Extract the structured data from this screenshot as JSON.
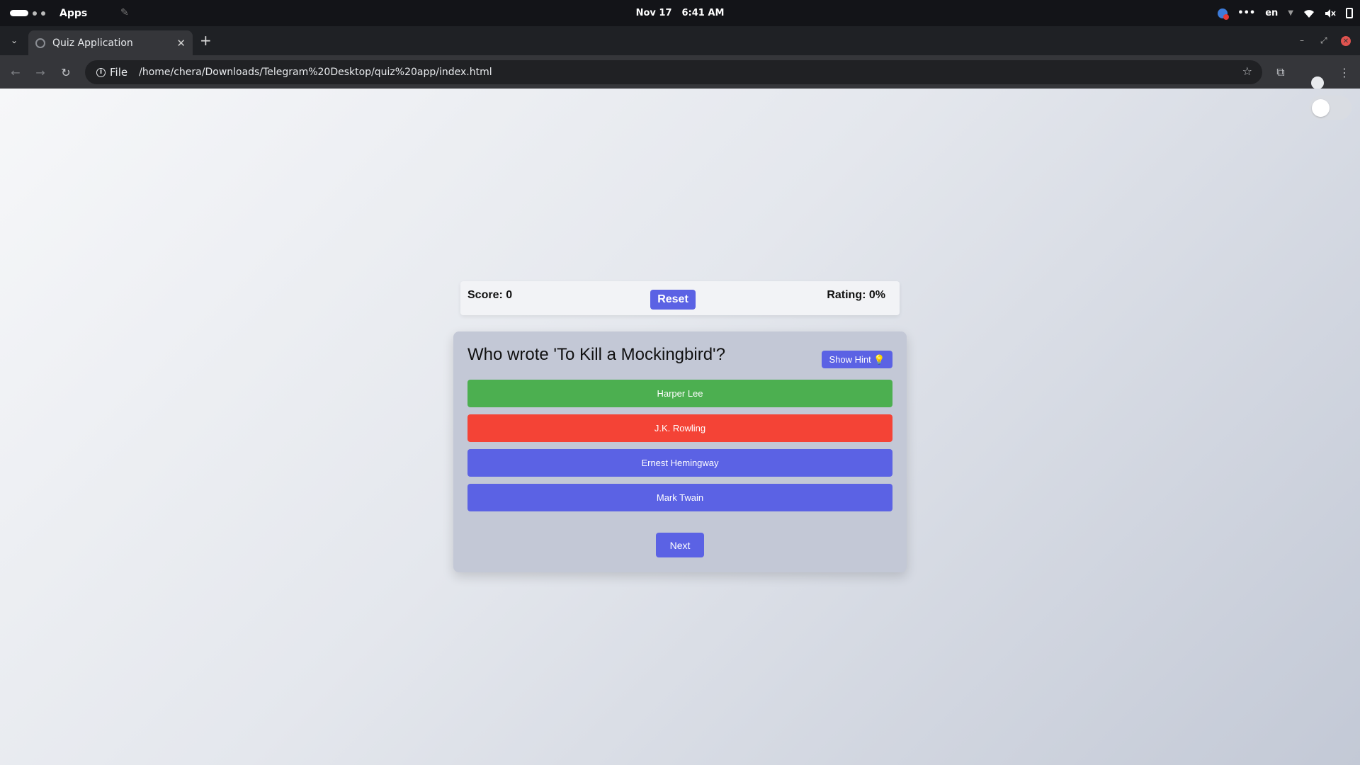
{
  "system_bar": {
    "apps_label": "Apps",
    "date": "Nov 17",
    "time": "6:41 AM",
    "language": "en",
    "more_glyph": "•••"
  },
  "browser": {
    "tab_title": "Quiz Application",
    "security_chip": "File",
    "url": "/home/chera/Downloads/Telegram%20Desktop/quiz%20app/index.html"
  },
  "quiz": {
    "score_label": "Score: 0",
    "reset_label": "Reset",
    "rating_label": "Rating: 0%",
    "question": "Who wrote 'To Kill a Mockingbird'?",
    "hint_label": "Show Hint 💡",
    "answers": [
      {
        "text": "Harper Lee",
        "state": "correct"
      },
      {
        "text": "J.K. Rowling",
        "state": "wrong"
      },
      {
        "text": "Ernest Hemingway",
        "state": "neutral"
      },
      {
        "text": "Mark Twain",
        "state": "neutral"
      }
    ],
    "next_label": "Next"
  },
  "colors": {
    "accent": "#5b62e4",
    "correct": "#4caf50",
    "wrong": "#f44336"
  },
  "icons": {
    "tab_list": "chevron-down-icon",
    "close_tab": "close-icon",
    "new_tab": "plus-icon",
    "back": "arrow-left-icon",
    "forward": "arrow-right-icon",
    "reload": "reload-icon",
    "bookmark": "star-icon",
    "extensions": "puzzle-icon",
    "profile": "user-icon",
    "menu": "kebab-menu-icon"
  }
}
